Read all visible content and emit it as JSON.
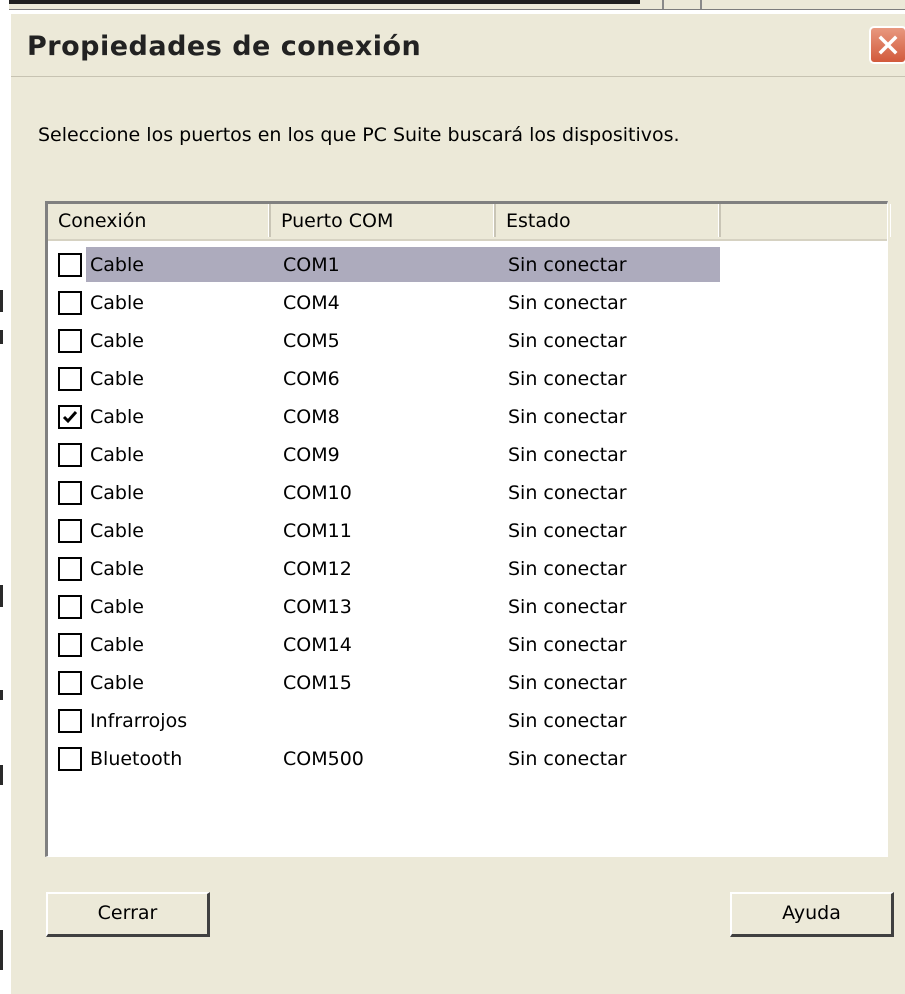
{
  "window": {
    "title": "Propiedades de conexión",
    "close_icon": "close-icon"
  },
  "instruction": "Seleccione los puertos en los que PC Suite buscará los dispositivos.",
  "table": {
    "columns": [
      "Conexión",
      "Puerto COM",
      "Estado",
      ""
    ],
    "rows": [
      {
        "checked": false,
        "selected": true,
        "conexion": "Cable",
        "puerto": "COM1",
        "estado": "Sin conectar"
      },
      {
        "checked": false,
        "selected": false,
        "conexion": "Cable",
        "puerto": "COM4",
        "estado": "Sin conectar"
      },
      {
        "checked": false,
        "selected": false,
        "conexion": "Cable",
        "puerto": "COM5",
        "estado": "Sin conectar"
      },
      {
        "checked": false,
        "selected": false,
        "conexion": "Cable",
        "puerto": "COM6",
        "estado": "Sin conectar"
      },
      {
        "checked": true,
        "selected": false,
        "conexion": "Cable",
        "puerto": "COM8",
        "estado": "Sin conectar"
      },
      {
        "checked": false,
        "selected": false,
        "conexion": "Cable",
        "puerto": "COM9",
        "estado": "Sin conectar"
      },
      {
        "checked": false,
        "selected": false,
        "conexion": "Cable",
        "puerto": "COM10",
        "estado": "Sin conectar"
      },
      {
        "checked": false,
        "selected": false,
        "conexion": "Cable",
        "puerto": "COM11",
        "estado": "Sin conectar"
      },
      {
        "checked": false,
        "selected": false,
        "conexion": "Cable",
        "puerto": "COM12",
        "estado": "Sin conectar"
      },
      {
        "checked": false,
        "selected": false,
        "conexion": "Cable",
        "puerto": "COM13",
        "estado": "Sin conectar"
      },
      {
        "checked": false,
        "selected": false,
        "conexion": "Cable",
        "puerto": "COM14",
        "estado": "Sin conectar"
      },
      {
        "checked": false,
        "selected": false,
        "conexion": "Cable",
        "puerto": "COM15",
        "estado": "Sin conectar"
      },
      {
        "checked": false,
        "selected": false,
        "conexion": "Infrarrojos",
        "puerto": "",
        "estado": "Sin conectar"
      },
      {
        "checked": false,
        "selected": false,
        "conexion": "Bluetooth",
        "puerto": "COM500",
        "estado": "Sin conectar"
      }
    ]
  },
  "buttons": {
    "close_label": "Cerrar",
    "help_label": "Ayuda"
  },
  "colors": {
    "dialog_bg": "#ece9d8",
    "selection": "#adabbd",
    "close_button": "#d25a3c"
  }
}
